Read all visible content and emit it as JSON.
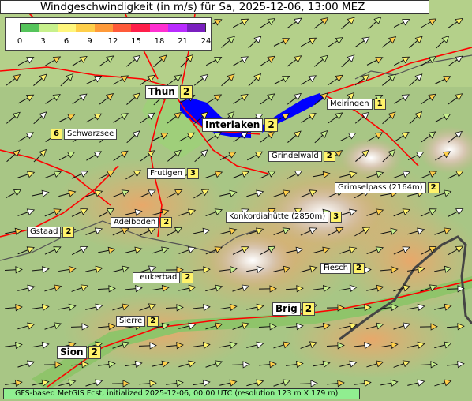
{
  "title": "Windgeschwindigkeit (in m/s) für Sa, 2025-12-06, 13:00 MEZ",
  "legend": {
    "colors": [
      "#55c45b",
      "#c7f08c",
      "#fff67c",
      "#ffcf4a",
      "#ff9a3a",
      "#ff5a3a",
      "#ff1e4a",
      "#ff2fd0",
      "#b92bff",
      "#7a1fbf"
    ],
    "ticks": [
      "0",
      "3",
      "6",
      "9",
      "12",
      "15",
      "18",
      "21",
      "24"
    ]
  },
  "places": [
    {
      "name": "Thun",
      "value": "2"
    },
    {
      "name": "Interlaken",
      "value": "2"
    },
    {
      "name": "Meiringen",
      "value": "1"
    },
    {
      "name": "Schwarzsee",
      "value": "6"
    },
    {
      "name": "Grindelwald",
      "value": "2"
    },
    {
      "name": "Frutigen",
      "value": "3"
    },
    {
      "name": "Grimselpass (2164m)",
      "value": "2"
    },
    {
      "name": "Konkordiahütte (2850m)",
      "value": "3"
    },
    {
      "name": "Adelboden",
      "value": "2"
    },
    {
      "name": "Gstaad",
      "value": "2"
    },
    {
      "name": "Fiesch",
      "value": "2"
    },
    {
      "name": "Leukerbad",
      "value": "2"
    },
    {
      "name": "Brig",
      "value": "2"
    },
    {
      "name": "Sierre",
      "value": "2"
    },
    {
      "name": "Sion",
      "value": "2"
    }
  ],
  "footer": "GFS-based MetGIS Fcst, initialized 2025-12-06, 00:00 UTC  (resolution 123 m X 179 m)",
  "colors": {
    "lake": "#0000ff",
    "road": "#ff0000",
    "border": "#555555",
    "arrow_fill": "#fff36b"
  }
}
